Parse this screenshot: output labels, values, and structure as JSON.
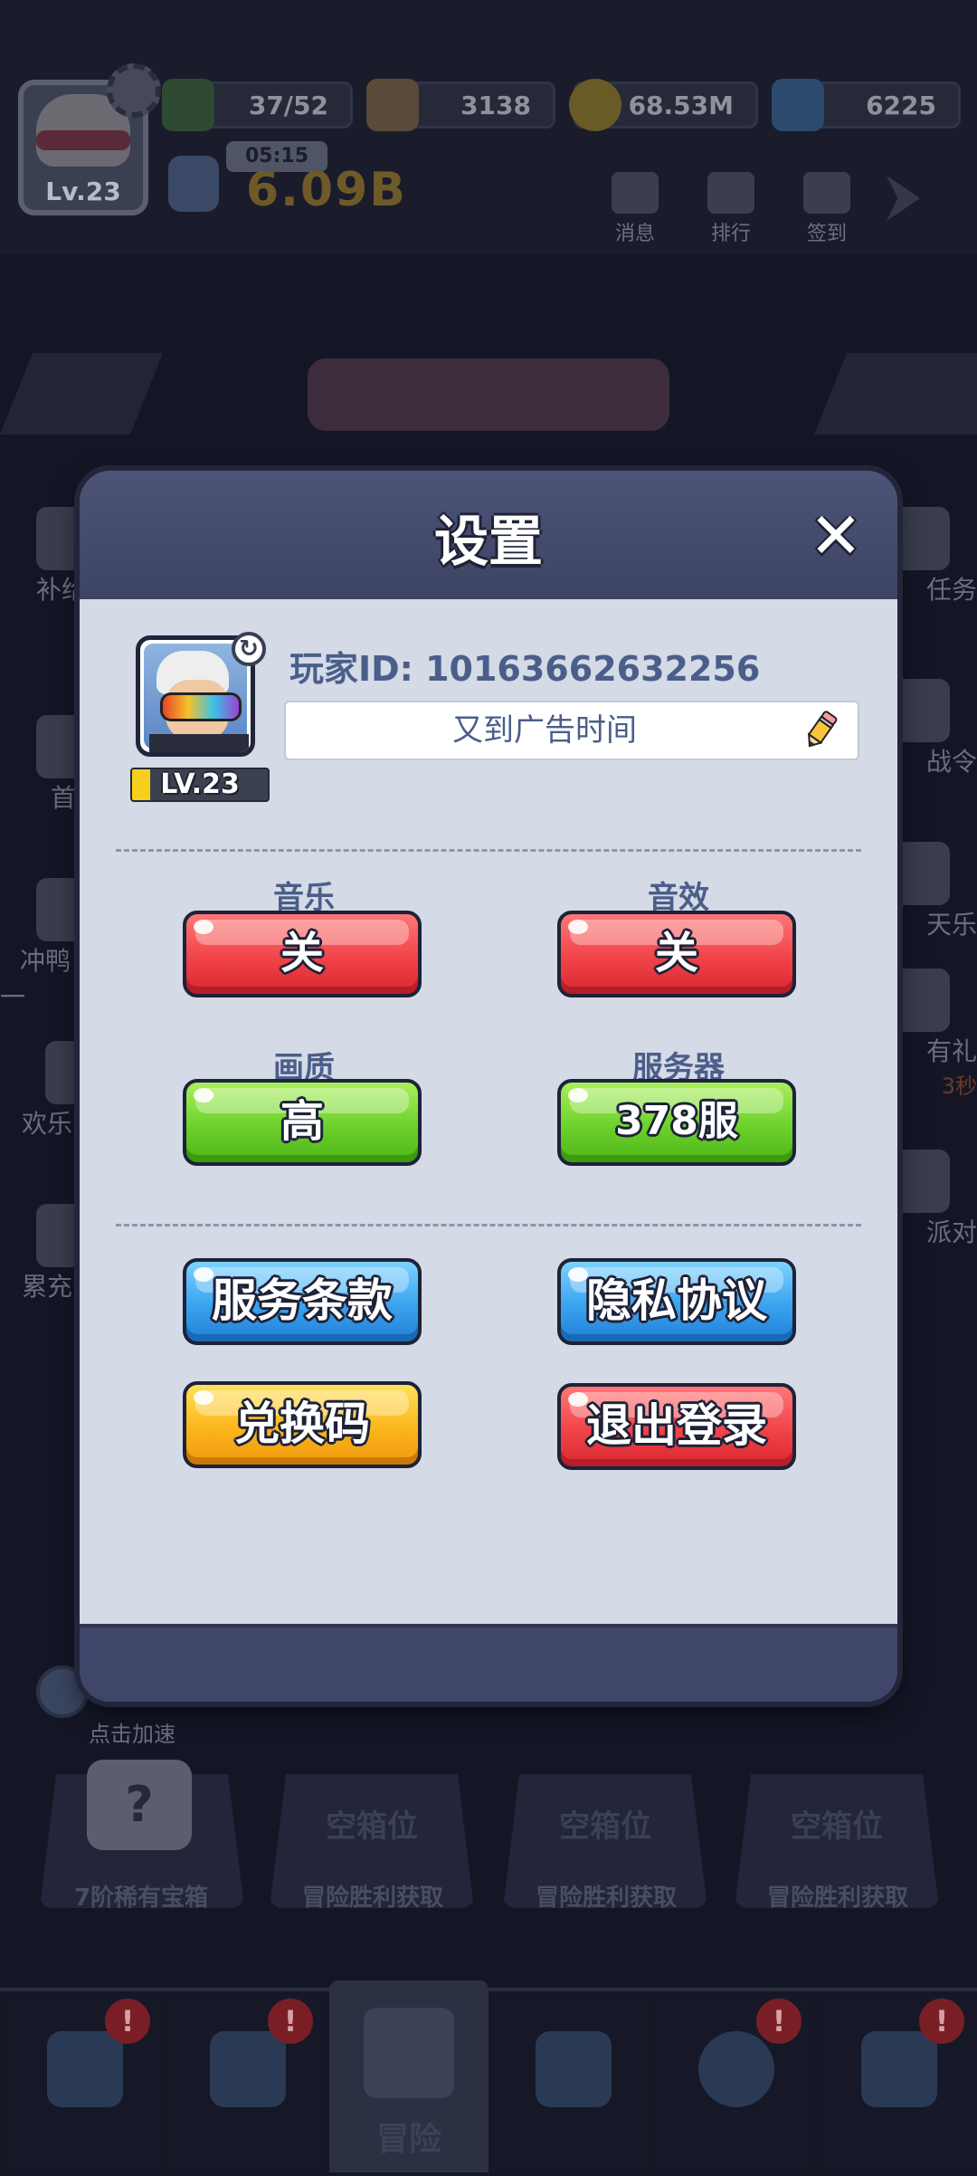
{
  "hud": {
    "level": "Lv.23",
    "energy": "37/52",
    "energy_timer": "05:15",
    "food": "3138",
    "coins": "68.53M",
    "gems": "6225",
    "power": "6.09B",
    "icons": [
      {
        "label": "消息"
      },
      {
        "label": "排行"
      },
      {
        "label": "签到"
      }
    ]
  },
  "side_left": [
    "补给",
    "首",
    "冲鸭一",
    "欢乐",
    "累充"
  ],
  "side_right": [
    "任务",
    "战令",
    "天乐",
    "有礼",
    "派对"
  ],
  "side_right_timer": "3秒",
  "speed_hint": "点击加速",
  "chest_slots": [
    {
      "title": "",
      "label": "7阶稀有宝箱"
    },
    {
      "title": "空箱位",
      "label": "冒险胜利获取"
    },
    {
      "title": "空箱位",
      "label": "冒险胜利获取"
    },
    {
      "title": "空箱位",
      "label": "冒险胜利获取"
    }
  ],
  "bottom_nav": {
    "active_label": "冒险",
    "badge": "!"
  },
  "settings": {
    "title": "设置",
    "close_symbol": "✕",
    "player_id_label": "玩家ID: 10163662632256",
    "player_name": "又到广告时间",
    "level_badge": "LV.23",
    "music_label": "音乐",
    "music_value": "关",
    "sfx_label": "音效",
    "sfx_value": "关",
    "quality_label": "画质",
    "quality_value": "高",
    "server_label": "服务器",
    "server_value": "378服",
    "terms_button": "服务条款",
    "privacy_button": "隐私协议",
    "redeem_button": "兑换码",
    "logout_button": "退出登录"
  },
  "colors": {
    "dialog_body": "#d4dae6",
    "dialog_frame": "#3c4260",
    "text_blue": "#4b5e8a",
    "red_button": "#f04449",
    "green_button": "#6dd12c",
    "blue_button": "#3aa3ef",
    "yellow_button": "#fbb51c"
  }
}
